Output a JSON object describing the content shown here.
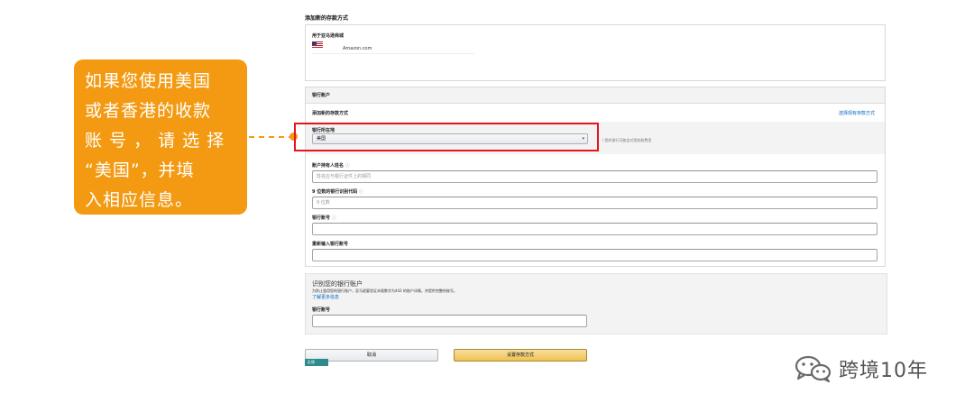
{
  "callout": {
    "lines": [
      "如果您使用美国",
      "或者香港的收款",
      "账 号 ， 请 选 择",
      "“美国”，并填",
      "入相应信息。"
    ],
    "color": "#f39a12"
  },
  "form": {
    "heading": "添加新的存款方式",
    "marketplace": {
      "label": "用于亚马逊商城",
      "flag_icon": "us-flag-icon",
      "name": "Amazon.com"
    },
    "bank_account": {
      "section_title": "银行账户",
      "subheading": "添加新的存款方式",
      "switch_link": "选择现有存款方式",
      "country_label": "银行所在地",
      "country_value": "美国",
      "country_hint": "i 您的银行可能会对您收取费用",
      "fields": [
        {
          "label": "账户持有人姓名",
          "placeholder": "姓名应与银行证件上的相同"
        },
        {
          "label": "9 位数的银行识别代码",
          "placeholder": "9 位数"
        },
        {
          "label": "银行账号",
          "placeholder": ""
        },
        {
          "label": "重新输入银行账号",
          "placeholder": ""
        }
      ]
    },
    "verify": {
      "title": "识别您的银行账户",
      "text": "为防止滥用您的银行账户，亚马逊要验证末尾数字为442 的账户详情，并提供完整的账号。",
      "link": "了解更多信息",
      "field_label": "银行账号"
    },
    "buttons": {
      "cancel": "取消",
      "submit": "设置存款方式"
    },
    "feedback_tag": "反馈",
    "highlight_color": "#e5151b"
  },
  "watermark": {
    "icon": "wechat-icon",
    "text": "跨境10年"
  }
}
